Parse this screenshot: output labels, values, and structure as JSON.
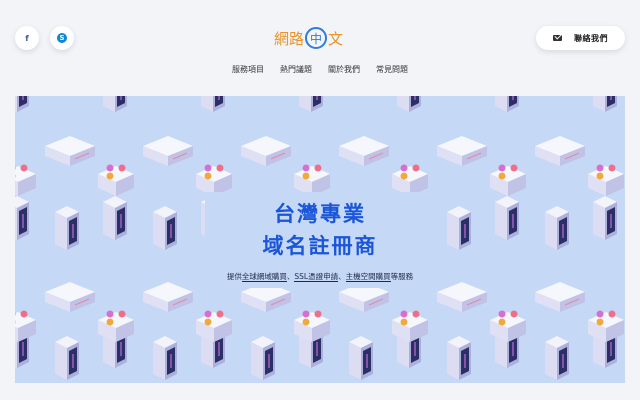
{
  "header": {
    "social": [
      {
        "name": "facebook",
        "glyph": "f"
      },
      {
        "name": "skype",
        "glyph": "S"
      }
    ],
    "logo": {
      "part1": "網路",
      "circle": "中",
      "part2": "文"
    },
    "contact_label": "聯絡我們"
  },
  "nav": [
    "服務項目",
    "熱門議題",
    "關於我們",
    "常見問題"
  ],
  "hero": {
    "title_line1": "台灣專業",
    "title_line2": "域名註冊商",
    "subtitle": {
      "prefix": "提供",
      "link1": "全球網域購買",
      "sep1": "、",
      "link2": "SSL憑證申請",
      "sep2": "、",
      "link3": "主機空間購買",
      "suffix": "等服務"
    }
  },
  "colors": {
    "page_bg": "#f2f4f7",
    "hero_bg": "#c5d8f5",
    "title": "#1b56d8",
    "logo_orange": "#e8932a",
    "logo_blue": "#2f7dd6"
  }
}
